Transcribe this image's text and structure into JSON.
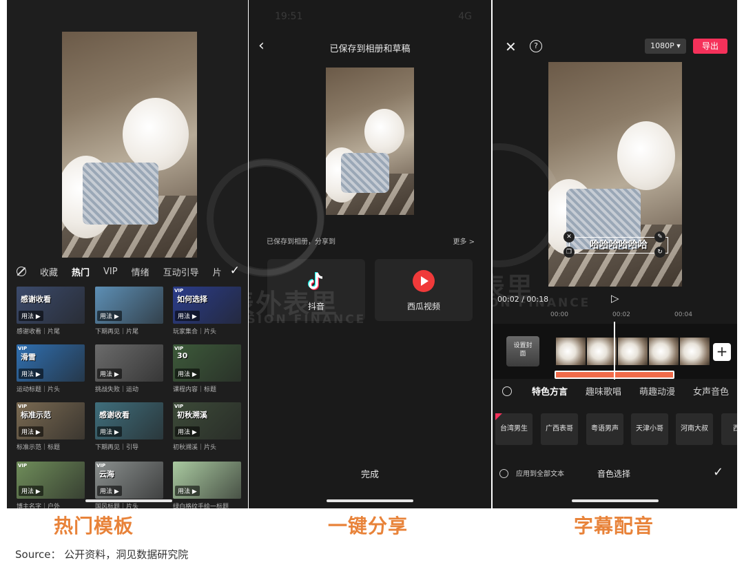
{
  "panel_templates": {
    "tabs": [
      "收藏",
      "热门",
      "VIP",
      "情绪",
      "互动引导",
      "片"
    ],
    "active_tab": "热门",
    "templates": [
      {
        "overlay": "感谢收看",
        "label": "感谢收看｜片尾",
        "vip": false,
        "color": "#3b4a6b"
      },
      {
        "overlay": "",
        "label": "下期再见｜片尾",
        "vip": false,
        "color": "#5d8fb5"
      },
      {
        "overlay": "如何选择",
        "label": "玩家集合｜片头",
        "vip": true,
        "color": "#2a3c8a"
      },
      {
        "overlay": "滑雪",
        "label": "运动标题｜片头",
        "vip": true,
        "color": "#2f6fb0"
      },
      {
        "overlay": "",
        "label": "挑战失败｜运动",
        "vip": false,
        "color": "#6b6b6b"
      },
      {
        "overlay": "30",
        "label": "课程内容｜标题",
        "vip": true,
        "color": "#3d5a3a"
      },
      {
        "overlay": "标准示范",
        "label": "标准示范｜标题",
        "vip": true,
        "color": "#7a6a52"
      },
      {
        "overlay": "感谢收看",
        "label": "下期再见｜引导",
        "vip": false,
        "color": "#3f6e7c"
      },
      {
        "overlay": "初秋溯溪",
        "label": "初秋溯溪｜片头",
        "vip": true,
        "color": "#3c4a38"
      },
      {
        "overlay": "",
        "label": "博主名字｜户外",
        "vip": true,
        "color": "#6f8d5a"
      },
      {
        "overlay": "云海",
        "label": "国风标题｜片头",
        "vip": true,
        "color": "#8a8f8e"
      },
      {
        "overlay": "",
        "label": "绿白格纹手绘一标题",
        "vip": false,
        "color": "#a9c9a0"
      }
    ],
    "badge": "用法 ▶",
    "vip_tag": "VIP",
    "caption": "热门模板"
  },
  "panel_share": {
    "status_time": "19:51",
    "status_right": "4G",
    "title": "已保存到相册和草稿",
    "saved_text": "已保存到相册，分享到",
    "more": "更多 >",
    "apps": [
      {
        "name": "抖音",
        "color": "#ffffff"
      },
      {
        "name": "西瓜视频",
        "color": "#f03a3a"
      }
    ],
    "done": "完成",
    "caption": "一键分享"
  },
  "panel_dub": {
    "resolution": "1080P ▾",
    "export": "导出",
    "subtitle": "哈哈哈哈哈哈",
    "timecode": "00:02 / 00:18",
    "ruler": [
      "00:00",
      "00:02",
      "00:04"
    ],
    "cover_label": "设置封面",
    "voice_tabs": [
      "特色方言",
      "趣味歌唱",
      "萌趣动漫",
      "女声音色"
    ],
    "active_voice_tab": "特色方言",
    "voices": [
      "台湾男生",
      "广西表哥",
      "粤语男声",
      "天津小哥",
      "河南大叔",
      "西安"
    ],
    "apply_all": "应用到全部文本",
    "sound_select": "音色选择",
    "caption": "字幕配音"
  },
  "watermark": {
    "cn": "表外表里",
    "en": "VISION FINANCE"
  },
  "source": "Source：  公开资料，洞见数据研究院"
}
